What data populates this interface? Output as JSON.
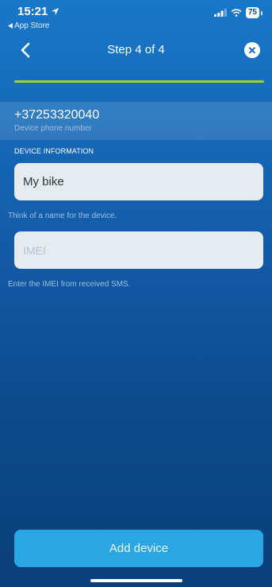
{
  "status_bar": {
    "time": "15:21",
    "back_app_label": "App Store",
    "battery": "75"
  },
  "nav": {
    "title": "Step 4 of 4"
  },
  "progress": {
    "current_step": 4,
    "total_steps": 4,
    "fraction": 1.0,
    "color": "#a8cf2d"
  },
  "device_phone": {
    "number": "+37253320040",
    "label": "Device phone number"
  },
  "device_information": {
    "header": "DEVICE INFORMATION",
    "name_field": {
      "value": "My bike",
      "hint": "Think of a name for the device."
    },
    "imei_field": {
      "placeholder": "IMEI",
      "hint": "Enter the IMEI from received SMS."
    }
  },
  "actions": {
    "add_device_label": "Add device",
    "add_device_color": "#2aa6e3"
  },
  "icons": {
    "back": "chevron-left-icon",
    "close": "close-circle-icon",
    "location": "location-arrow-icon",
    "signal": "signal-icon",
    "wifi": "wifi-icon",
    "battery": "battery-icon"
  }
}
